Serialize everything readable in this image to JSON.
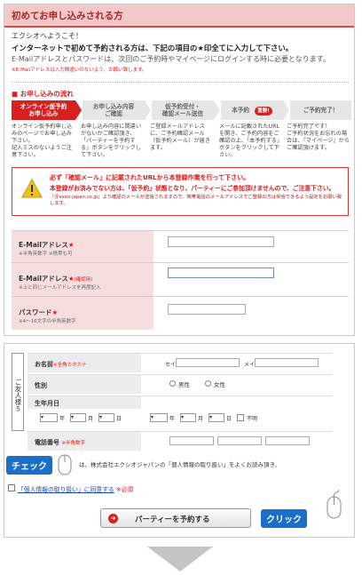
{
  "top_panel": {
    "header_title": "初めてお申し込みされる方",
    "welcome": "エクシオへようこそ！",
    "intro_line": "インターネットで初めて予約される方は、下記の項目の★印全てに入力して下さい。",
    "email_note": "E-Mailアドレスとパスワードは、次回のご予約時やマイページにログインする時に必要となります。",
    "email_warning": "※E-Mailアドレスは入力間違いのないよう、お願い致します。",
    "flow_title": "■ お申し込みの流れ",
    "steps": [
      {
        "label": "オンライン仮予約\nお申し込み",
        "desc": "オンライン仮予約申し込みのページでお申し込み下さい。\n記入ミスのないようご注意下さい。"
      },
      {
        "label": "お申し込み内容\nご確認",
        "desc": "お申し込み内容に間違いがないかご確認頂き、「パーティーを予約する」ボタンをクリックして下さい。"
      },
      {
        "label": "仮予約受付・\n確認メール送信",
        "desc": "ご登録メールアドレスに、ご予約確認メール（仮予約メール）が届きます。"
      },
      {
        "label": "本予約",
        "badge": "重要!",
        "desc": "メールに記載されたURLを開き、ご予約内容をご確認の上、「本予約する」ボタンをクリックして下さい。"
      },
      {
        "label": "ご予約完了！",
        "desc": "ご予約完了です！\nご予約状況をお忘れの場合は、『マイページ』からご確認頂けます。"
      }
    ],
    "warning_line1": "必ず「確認メール」に記載されたURLから本登録作業を行って下さい。",
    "warning_line2": "本登録がお済みでない方は、「仮予約」状態となり、パーティーにご参加頂けませんので、ご注意下さい。",
    "warning_line3": "「＠exeo-japan.co.jp」より確認のメールが送信されますので、携帯電話のメールアドレスでご登録の方は受信できるよう設定をお願い致します。",
    "fields": [
      {
        "label": "E-Mailアドレス",
        "star": "★",
        "note": "※半角英数字 ※携帯も可"
      },
      {
        "label": "E-Mailアドレス",
        "star": "★",
        "extra": "(確認用)",
        "note": "※上と同じメールアドレスを再度記入"
      },
      {
        "label": "パスワード",
        "star": "★",
        "note": "※4〜16文字の半角英数字"
      }
    ]
  },
  "bottom_panel": {
    "side_label": "ご友人様５",
    "name": {
      "label": "お名前",
      "note": "※全角カタカナ",
      "sei": "セイ",
      "mei": "メイ"
    },
    "gender": {
      "label": "性別",
      "male": "男性",
      "female": "女性"
    },
    "birthday": {
      "label": "生年月日",
      "parts": [
        "年",
        "月",
        "日",
        "年",
        "月",
        "日"
      ],
      "unknown": "不明"
    },
    "phone": {
      "label": "電話番号",
      "note": "※半角数字"
    },
    "privacy_text": "は、株式会社エクシオジャパンの「個人情報の取り扱い」をよくお読み頂き、",
    "check_tag": "チェック",
    "agree_text": "「個人情報の取り扱い」に同意する",
    "agree_required": "※必須",
    "submit_label": "パーティーを予約する",
    "click_tag": "クリック"
  },
  "colors": {
    "accent": "#d8211f",
    "header_bg": "#f4c8c9",
    "tag_blue": "#1a6fc9"
  }
}
